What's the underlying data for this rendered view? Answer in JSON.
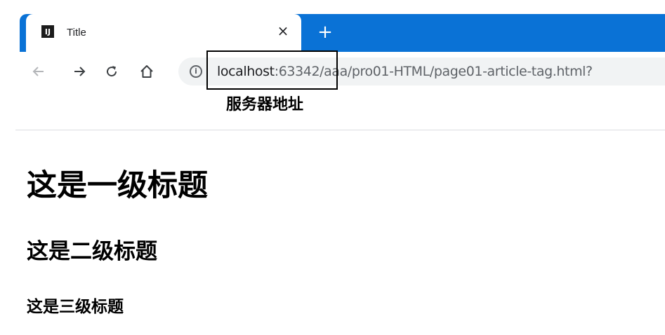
{
  "tab": {
    "title": "Title",
    "favicon_text": "IJ",
    "close_glyph": "×",
    "new_tab_glyph": "+"
  },
  "toolbar": {
    "back_icon": "arrow-left-icon",
    "forward_icon": "arrow-right-icon",
    "reload_icon": "reload-icon",
    "home_icon": "home-icon",
    "info_glyph": "i"
  },
  "address_bar": {
    "host": "localhost",
    "rest": ":63342/aaa/pro01-HTML/page01-article-tag.html?"
  },
  "annotation": {
    "label": "服务器地址"
  },
  "page": {
    "h1": "这是一级标题",
    "h2": "这是二级标题",
    "h3": "这是三级标题"
  },
  "colors": {
    "tabstrip": "#0a72d6",
    "omnibox": "#f1f3f4"
  }
}
